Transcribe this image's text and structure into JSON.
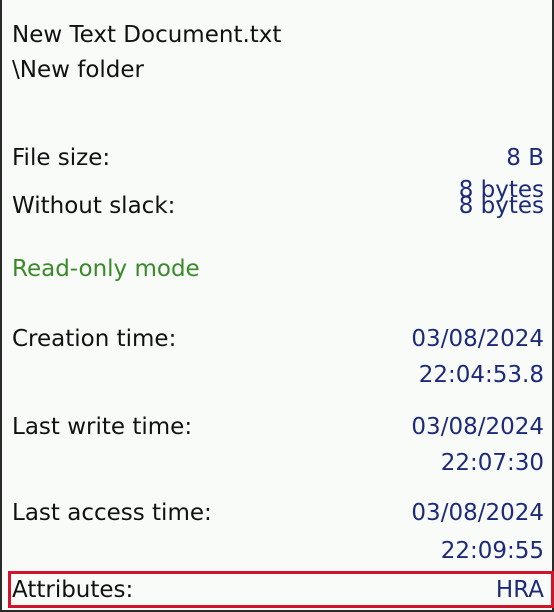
{
  "file": {
    "name": "New Text Document.txt",
    "path": "\\New folder"
  },
  "size": {
    "label": "File size:",
    "value": "8 B",
    "bytes": "8 bytes",
    "without_slack_label": "Without slack:",
    "without_slack_value": "8 bytes"
  },
  "mode": {
    "text": "Read-only mode"
  },
  "times": {
    "creation_label": "Creation time:",
    "creation_date": "03/08/2024",
    "creation_time": "22:04:53.8",
    "write_label": "Last write time:",
    "write_date": "03/08/2024",
    "write_time": "22:07:30",
    "access_label": "Last access time:",
    "access_date": "03/08/2024",
    "access_time": "22:09:55"
  },
  "attributes": {
    "label": "Attributes:",
    "value": "HRA",
    "highlight_color": "#d0142a"
  }
}
